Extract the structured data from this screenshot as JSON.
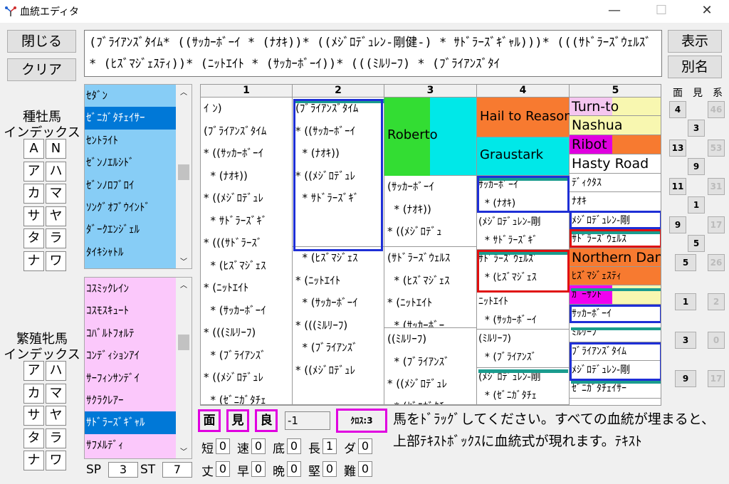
{
  "window": {
    "title": "血統エディタ",
    "minimize": "—",
    "maximize": "☐",
    "close": "✕"
  },
  "buttons": {
    "close": "閉じる",
    "clear": "クリア",
    "display": "表示",
    "alias": "別名"
  },
  "formula": "(ﾌﾞﾗｲｱﾝｽﾞﾀｲﾑ* ((ｻｯｶｰﾎﾞｰｲ * (ﾅｵｷ))* ((ﾒｼﾞﾛﾃﾞｭﾚﾝ-剛健-) * ｻﾄﾞﾗｰｽﾞｷﾞｬﾙ)))* (((ｻﾄﾞﾗｰｽﾞｳｪﾙｽﾞ * (ﾋｽﾞﾏｼﾞｪｽﾃｨ))* (ﾆｯﾄｴｲﾄ * (ｻｯｶｰﾎﾞｰｲ))* (((ﾐﾙﾘｰﾌ) * (ﾌﾞﾗｲｱﾝｽﾞﾀｲ",
  "stallion": {
    "label1": "種牡馬",
    "label2": "インデックス",
    "kana": [
      [
        "A",
        "N"
      ],
      [
        "ア",
        "ハ"
      ],
      [
        "カ",
        "マ"
      ],
      [
        "サ",
        "ヤ"
      ],
      [
        "タ",
        "ラ"
      ],
      [
        "ナ",
        "ワ"
      ]
    ],
    "items": [
      "ｾﾀﾞﾝ",
      "ｾﾞﾆｶﾞﾀﾁｪｲｻｰ",
      "ｾﾝﾄﾗｲﾄ",
      "ｾﾞﾝﾉｴﾙｼﾄﾞ",
      "ｾﾞﾝﾉﾛﾌﾞﾛｲ",
      "ｿﾝｸﾞｵﾌﾞｳｲﾝﾄﾞ",
      "ﾀﾞｰｸｴﾝｼﾞｪﾙ",
      "ﾀｲｷｼｬﾄﾙ"
    ],
    "selected_index": 1,
    "color": "#87cdf6"
  },
  "mare": {
    "label1": "繁殖牝馬",
    "label2": "インデックス",
    "kana": [
      [
        "ア",
        "ハ"
      ],
      [
        "カ",
        "マ"
      ],
      [
        "サ",
        "ヤ"
      ],
      [
        "タ",
        "ラ"
      ],
      [
        "ナ",
        "ワ"
      ]
    ],
    "items": [
      "ｺｽﾐｯｸﾚｲﾝ",
      "ｺｽﾓｽｷｭｰﾄ",
      "ｺﾊﾞﾙﾄﾌｫﾙﾃ",
      "ｺﾝﾃﾞｨｼｮﾝｱｲ",
      "ｻｰﾌｨﾝｻﾝﾃﾞｲ",
      "ｻｸﾗｸﾚｱｰ",
      "ｻﾄﾞﾗｰｽﾞｷﾞｬﾙ",
      "ｻﾌﾒﾙﾃﾞｨ"
    ],
    "selected_index": 6,
    "color": "#fbc8fb"
  },
  "grid": {
    "headers": [
      "1",
      "2",
      "3",
      "4",
      "5"
    ],
    "col1": [
      "ｲ ﾝ)",
      "(ﾌﾞﾗｲｱﾝｽﾞﾀｲﾑ",
      "* ((ｻｯｶｰﾎﾞｰｲ",
      "  * (ﾅｵｷ))",
      "* ((ﾒｼﾞﾛﾃﾞｭﾚ",
      "  * ｻﾄﾞﾗｰｽﾞｷﾞ",
      "* (((ｻﾄﾞﾗｰｽﾞ",
      "  * (ﾋｽﾞﾏｼﾞｪｽ",
      "* (ﾆｯﾄｴｲﾄ",
      "  * (ｻｯｶｰﾎﾞｰｲ",
      "* (((ﾐﾙﾘｰﾌ)",
      "  * (ﾌﾞﾗｲｱﾝｽﾞ",
      "* ((ﾒｼﾞﾛﾃﾞｭﾚ",
      "  * (ｾﾞﾆｶﾞﾀﾁｪ"
    ],
    "col2_top": [
      "(ﾌﾞﾗｲｱﾝｽﾞﾀｲﾑ",
      "* ((ｻｯｶｰﾎﾞｰｲ",
      "  * (ﾅｵｷ))",
      "* ((ﾒｼﾞﾛﾃﾞｭﾚ",
      "  * ｻﾄﾞﾗｰｽﾞｷﾞ"
    ],
    "col2_bottom": [
      "  * (ﾋｽﾞﾏｼﾞｪｽ",
      "* (ﾆｯﾄｴｲﾄ",
      "  * (ｻｯｶｰﾎﾞｰｲ",
      "* (((ﾐﾙﾘｰﾌ)",
      "  * (ﾌﾞﾗｲｱﾝｽﾞ",
      "* ((ﾒｼﾞﾛﾃﾞｭﾚ"
    ],
    "col3_roberto": "Roberto",
    "col3_a": [
      "(ｻｯｶｰﾎﾞｰｲ",
      "  * (ﾅｵｷ))",
      "* ((ﾒｼﾞﾛﾃﾞｭ"
    ],
    "col3_b": [
      "(ｻﾄﾞﾗｰｽﾞｳｪﾙｽ",
      "  * (ﾋｽﾞﾏｼﾞｪｽ",
      "* (ﾆｯﾄｴｲﾄ",
      "  * (ｻｯｶｰﾎﾞｰ"
    ],
    "col3_c": [
      "((ﾐﾙﾘｰﾌ)",
      "  * (ﾌﾞﾗｲｱﾝｽﾞ",
      "* ((ﾒｼﾞﾛﾃﾞｭﾚ",
      "  * (ｾﾞﾆｶﾞﾀﾁ"
    ],
    "col4_hail": "Hail to Reason",
    "col4_graustark": "Graustark",
    "col4_a": [
      "ｻｯｶｰﾎﾞｰｲ",
      "  * (ﾅｵｷ)"
    ],
    "col4_b": [
      "(ﾒｼﾞﾛﾃﾞｭﾚﾝ-剛",
      "  * ｻﾄﾞﾗｰｽﾞｷﾞ"
    ],
    "col4_c": [
      "ｻﾄﾞﾗｰｽﾞｳｪﾙｽﾞ",
      "  * (ﾋｽﾞﾏｼﾞｪｽ"
    ],
    "col4_d": [
      "ﾆｯﾄｴｲﾄ",
      "  * (ｻｯｶｰﾎﾞｰｲ"
    ],
    "col4_e": [
      "(ﾐﾙﾘｰﾌ)",
      "  * (ﾌﾞﾗｲｱﾝｽﾞ"
    ],
    "col4_f": [
      "(ﾒｼﾞﾛﾃﾞｭﾚﾝ-剛",
      "  * (ｾﾞﾆｶﾞﾀﾁｪ"
    ],
    "col5": [
      "Turn-to",
      "Nashua",
      "Ribot",
      "Hasty Road",
      "ﾃﾞｨｸﾀｽ",
      "ﾅｵｷ",
      "ﾒｼﾞﾛﾃﾞｭﾚﾝ-剛",
      "ｻﾄﾞﾗｰｽﾞｳｪﾙｽ",
      "Northern Dancer",
      "ﾋｽﾞﾏｼﾞｪｽﾃｨ",
      "ｶﾞｰｻﾝﾄ",
      "ｻｯｶｰﾎﾞｰｲ",
      "ﾐﾙﾘｰﾌ",
      "ﾌﾞﾗｲｱﾝｽﾞﾀｲﾑ",
      "ﾒｼﾞﾛﾃﾞｭﾚﾝ-剛",
      "ｾﾞﾆｶﾞﾀﾁｪｲｻｰ"
    ]
  },
  "right_panel": {
    "headers": [
      "面",
      "見",
      "系"
    ],
    "rows": [
      {
        "a": "4",
        "b": "46"
      },
      {
        "c": "3"
      },
      {
        "a": "13",
        "b": "53"
      },
      {
        "c": "9"
      },
      {
        "a": "11",
        "b": "31"
      },
      {
        "c": "1"
      },
      {
        "a": "9",
        "b": "17"
      },
      {
        "c": "5"
      },
      {
        "a": "5",
        "b": "26"
      },
      {
        "a": "1",
        "b": "2"
      },
      {
        "a": "3",
        "b": "0"
      },
      {
        "a": "9",
        "b": "17"
      }
    ]
  },
  "bottom": {
    "tags": [
      "面",
      "見",
      "良"
    ],
    "value": "-1",
    "cross": "ｸﾛｽ:3",
    "message": "馬をﾄﾞﾗｯｸﾞしてください。すべての血統が埋まると、上部ﾃｷｽﾄﾎﾞｯｸｽに血統式が現れます。ﾃｷｽﾄ",
    "stats_row1": [
      [
        "短",
        "0"
      ],
      [
        "速",
        "0"
      ],
      [
        "底",
        "0"
      ],
      [
        "長",
        "1"
      ],
      [
        "ダ",
        "0"
      ]
    ],
    "stats_row2": [
      [
        "丈",
        "0"
      ],
      [
        "早",
        "0"
      ],
      [
        "晩",
        "0"
      ],
      [
        "堅",
        "0"
      ],
      [
        "難",
        "0"
      ]
    ],
    "sp_label": "SP",
    "sp_value": "3",
    "st_label": "ST",
    "st_value": "7"
  }
}
